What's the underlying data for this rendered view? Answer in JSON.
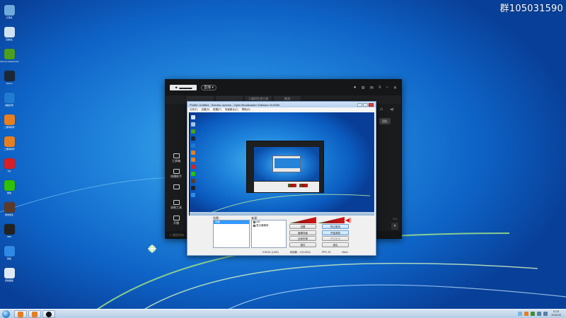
{
  "watermark": "群105031590",
  "desktop_icons": [
    {
      "label": "计算机",
      "icon": "computer-icon",
      "color": "#6fa8dc"
    },
    {
      "label": "回收站",
      "icon": "recycle-bin-icon",
      "color": "#cfe2f3"
    },
    {
      "label": "GeForce Experience",
      "icon": "nvidia-icon",
      "color": "#4b9e1e"
    },
    {
      "label": "Steam",
      "icon": "steam-icon",
      "color": "#1b2838"
    },
    {
      "label": "电脑管家",
      "icon": "shield-icon",
      "color": "#1f7bd1"
    },
    {
      "label": "二维码制作",
      "icon": "qrcode-app-icon",
      "color": "#e67e22"
    },
    {
      "label": "二维码制作",
      "icon": "qrcode-app-icon-2",
      "color": "#e67e22"
    },
    {
      "label": "QQ",
      "icon": "qq-icon",
      "color": "#d61f26"
    },
    {
      "label": "微信",
      "icon": "wechat-icon",
      "color": "#2dc100"
    },
    {
      "label": "绝地求生",
      "icon": "game-icon",
      "color": "#5b3a29"
    },
    {
      "label": "OBS",
      "icon": "obs-icon",
      "color": "#222222"
    },
    {
      "label": "网盘",
      "icon": "cloud-icon",
      "color": "#2e8ae6"
    },
    {
      "label": "控制面板",
      "icon": "control-panel-icon",
      "color": "#dfe9f5"
    }
  ],
  "dark_app": {
    "title_pill": "直播 ▾",
    "tabs": [
      "",
      "",
      "二维码生成工具",
      "推流"
    ],
    "side_items": [
      "工具箱",
      "热播助手",
      "",
      "录制工具",
      "开播"
    ],
    "right_badge": "团队",
    "bottom_text": "0.0",
    "footer": "© 版权所有 ...."
  },
  "obs": {
    "title": "Profile: Untitled - Scenes: scenes - Open Broadcaster Software v0.659b",
    "menu": [
      "文件(F)",
      "设置(S)",
      "配置(P)",
      "场景集合(C)",
      "帮助(H)"
    ],
    "scenes_label": "场景：",
    "sources_label": "来源：",
    "scenes": [
      "场景"
    ],
    "sources": [
      "obs",
      "显示器捕获"
    ],
    "buttons": [
      {
        "label": "设置",
        "variant": "normal"
      },
      {
        "label": "停止推流",
        "variant": "blue"
      },
      {
        "label": "编辑场景",
        "variant": "normal"
      },
      {
        "label": "开始录制",
        "variant": "blue"
      },
      {
        "label": "全局来源",
        "variant": "normal"
      },
      {
        "label": "预览推流",
        "variant": "disabled"
      },
      {
        "label": "插件",
        "variant": "normal"
      },
      {
        "label": "退出",
        "variant": "normal"
      }
    ],
    "status": [
      "0:00:01 (LIVE)",
      "丢帧数：0 (0.00%)",
      "FPS: 32",
      "0kb/s"
    ]
  },
  "taskbar": {
    "clock_time": "11:23",
    "clock_date": "2015/1/5"
  }
}
